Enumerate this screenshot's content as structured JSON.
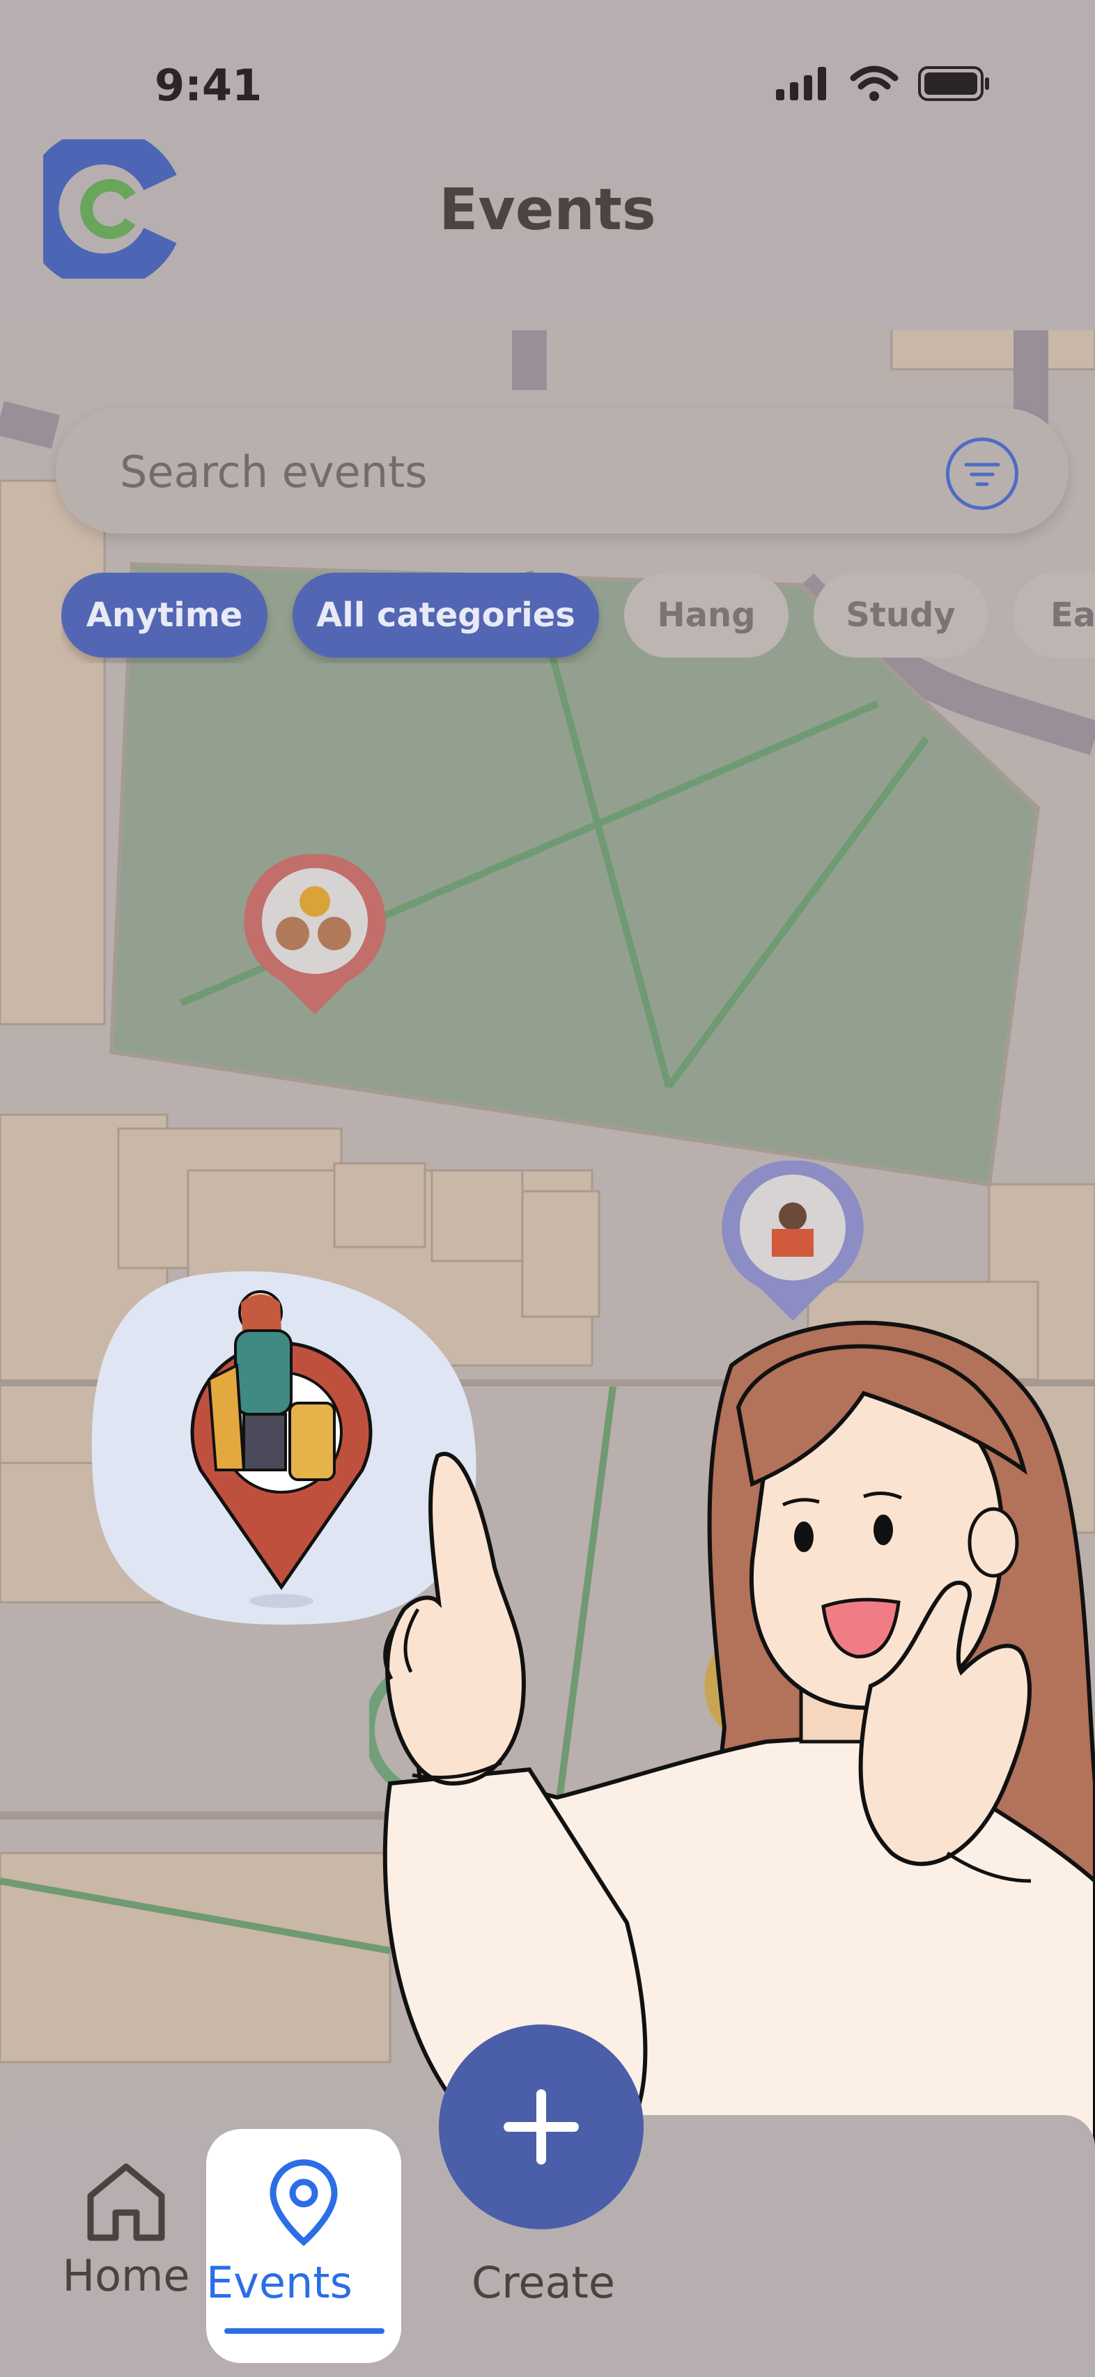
{
  "status_bar": {
    "time": "9:41"
  },
  "header": {
    "title": "Events"
  },
  "search": {
    "placeholder": "Search events"
  },
  "chips": [
    {
      "label": "Anytime",
      "active": true
    },
    {
      "label": "All categories",
      "active": true
    },
    {
      "label": "Hang",
      "active": false
    },
    {
      "label": "Study",
      "active": false
    },
    {
      "label": "Ea",
      "active": false
    }
  ],
  "bottom_nav": {
    "home_label": "Home",
    "events_label": "Events",
    "create_label": "Create",
    "active": "Events"
  },
  "icons": [
    "signal-icon",
    "wifi-icon",
    "battery-icon",
    "filter-icon",
    "home-icon",
    "location-pin-icon",
    "plus-icon"
  ],
  "colors": {
    "accent": "#5266b4",
    "active_tab": "#2b6ee6",
    "pin_red": "#c24a3a",
    "pin_purple": "#8b8dc4",
    "pin_green": "#6fa07a"
  }
}
